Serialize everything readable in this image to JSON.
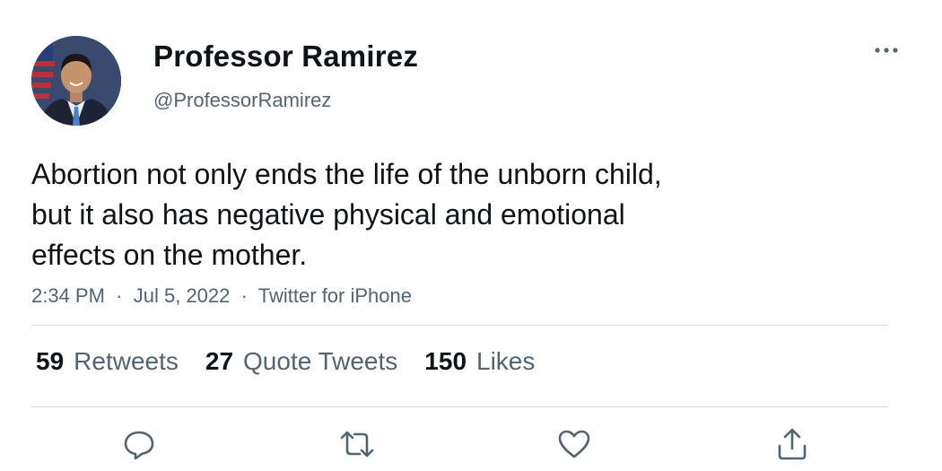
{
  "author": {
    "display_name": "Professor Ramirez",
    "handle": "@ProfessorRamirez"
  },
  "tweet": {
    "text_lines": [
      "Abortion not only ends the life of the unborn child,",
      "but it also has negative physical and emotional",
      "effects on the mother."
    ],
    "time": "2:34 PM",
    "date": "Jul 5, 2022",
    "source": "Twitter for iPhone",
    "separator": "·"
  },
  "stats": {
    "retweets": {
      "count": "59",
      "label": "Retweets"
    },
    "quote_tweets": {
      "count": "27",
      "label": "Quote Tweets"
    },
    "likes": {
      "count": "150",
      "label": "Likes"
    }
  },
  "actions": [
    "reply-icon",
    "retweet-icon",
    "like-icon",
    "share-icon"
  ],
  "colors": {
    "text": "#0f1419",
    "secondary": "#536471",
    "divider": "#cfd9de"
  }
}
